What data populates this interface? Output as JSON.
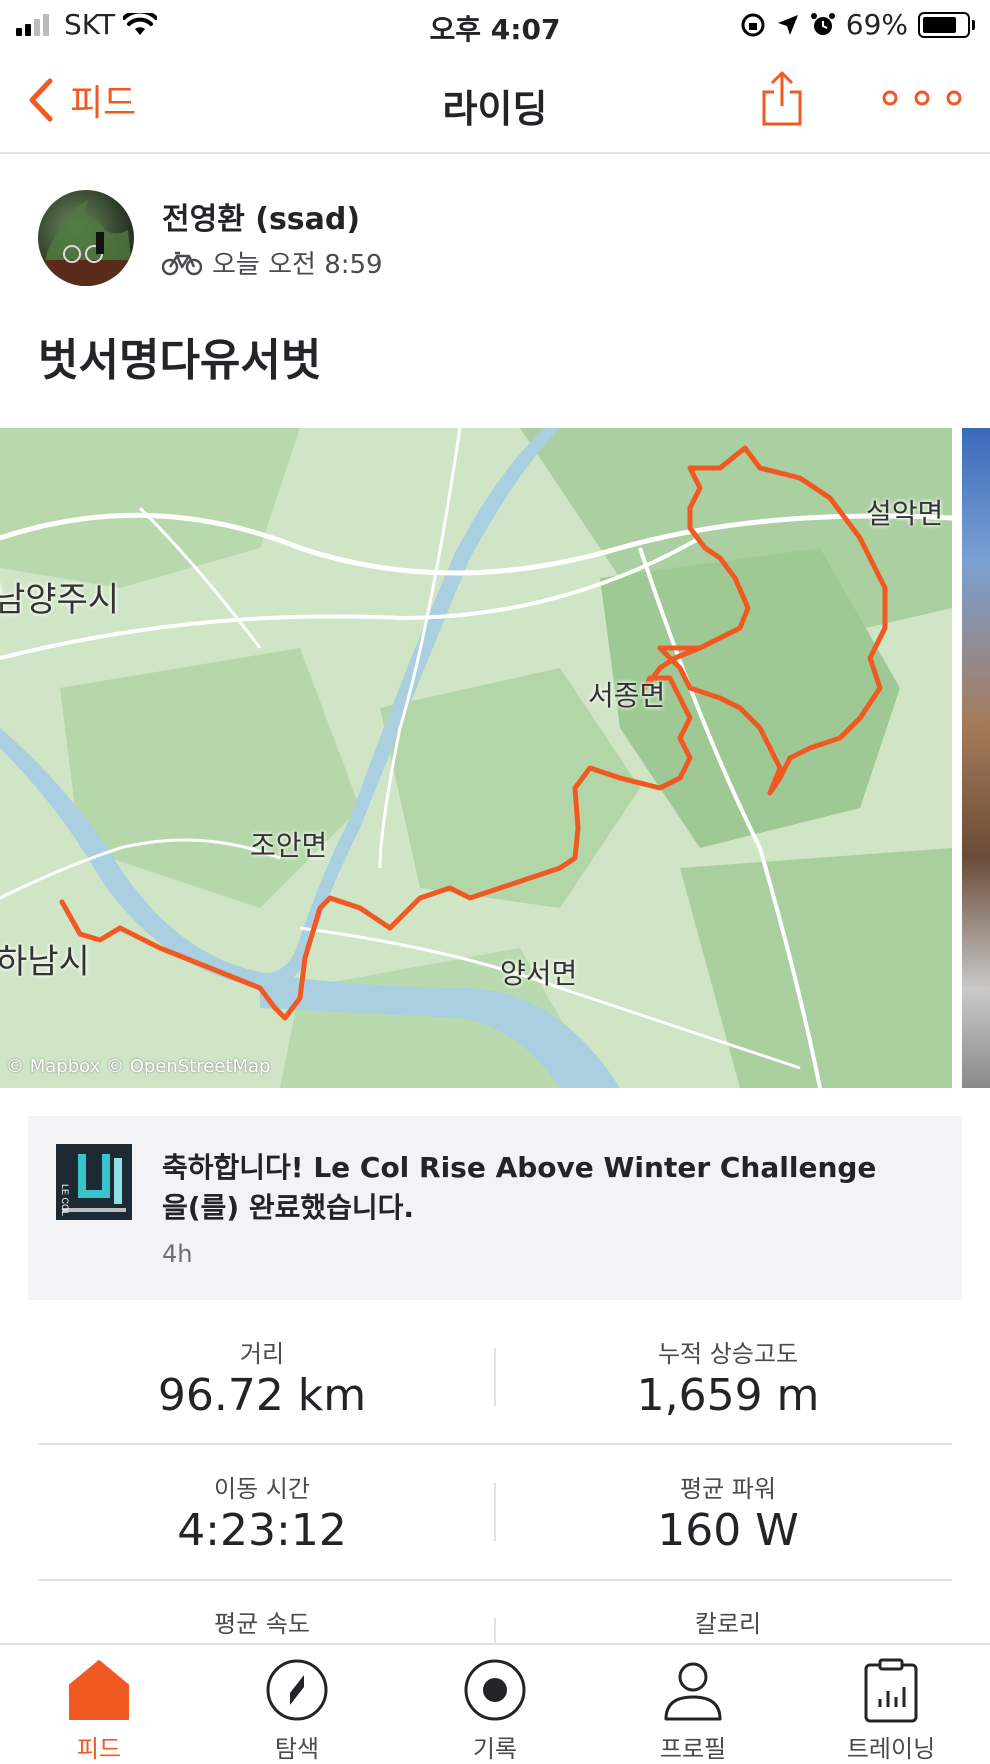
{
  "status_bar": {
    "carrier": "SKT",
    "time": "오후 4:07",
    "battery": "69%"
  },
  "nav": {
    "back_label": "피드",
    "title": "라이딩"
  },
  "author": {
    "name": "전영환 (ssad)",
    "timestamp": "오늘 오전 8:59"
  },
  "activity": {
    "title": "벗서명다유서벗"
  },
  "map": {
    "labels": [
      "설악면",
      "남양주시",
      "서종면",
      "조안면",
      "하남시",
      "양서면"
    ],
    "attribution": "© Mapbox © OpenStreetMap",
    "route_color": "#f05a22"
  },
  "challenge": {
    "text": "축하합니다! Le Col Rise Above Winter Challenge을(를) 완료했습니다.",
    "time": "4h",
    "badge_text": "LE COL"
  },
  "stats": [
    {
      "label": "거리",
      "value": "96.72 km"
    },
    {
      "label": "누적 상승고도",
      "value": "1,659 m"
    },
    {
      "label": "이동 시간",
      "value": "4:23:12"
    },
    {
      "label": "평균 파워",
      "value": "160 W"
    },
    {
      "label": "평균 속도",
      "value": ""
    },
    {
      "label": "칼로리",
      "value": ""
    }
  ],
  "tabs": [
    {
      "label": "피드",
      "icon": "home-icon",
      "active": true
    },
    {
      "label": "탐색",
      "icon": "compass-icon",
      "active": false
    },
    {
      "label": "기록",
      "icon": "record-icon",
      "active": false
    },
    {
      "label": "프로필",
      "icon": "profile-icon",
      "active": false
    },
    {
      "label": "트레이닝",
      "icon": "training-icon",
      "active": false
    }
  ],
  "colors": {
    "accent": "#f05a22",
    "text": "#242428",
    "muted": "#6d6d78",
    "card_bg": "#f3f3f5"
  }
}
